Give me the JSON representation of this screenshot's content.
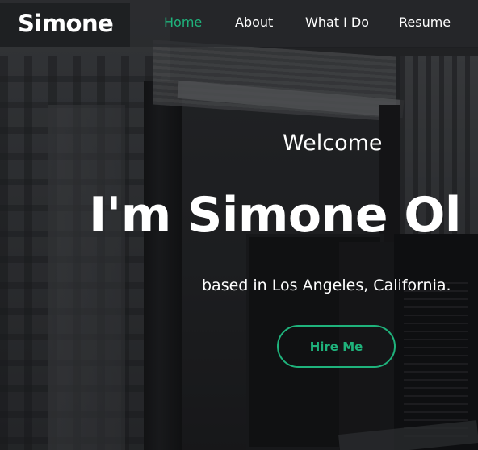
{
  "nav": {
    "brand": "Simone",
    "items": [
      {
        "label": "Home",
        "active": true
      },
      {
        "label": "About",
        "active": false
      },
      {
        "label": "What I Do",
        "active": false
      },
      {
        "label": "Resume",
        "active": false
      }
    ]
  },
  "hero": {
    "welcome": "Welcome",
    "name": "I'm Simone Ol",
    "subtitle": "based in Los Angeles, California.",
    "cta_label": "Hire Me"
  },
  "colors": {
    "accent": "#1fb37c",
    "text": "#ffffff",
    "nav_bg": "#2a2c2e"
  }
}
